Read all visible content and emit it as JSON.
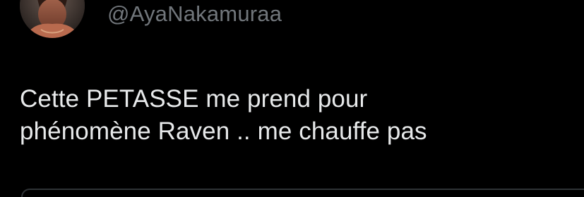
{
  "tweet": {
    "handle": "@AyaNakamuraa",
    "text_lines": [
      "Cette PETASSE me prend pour",
      "phénomène Raven .. me chauffe pas"
    ]
  },
  "colors": {
    "background": "#000000",
    "text": "#e7e9ea",
    "secondary_text": "#71767b",
    "divider": "#2f3336"
  }
}
